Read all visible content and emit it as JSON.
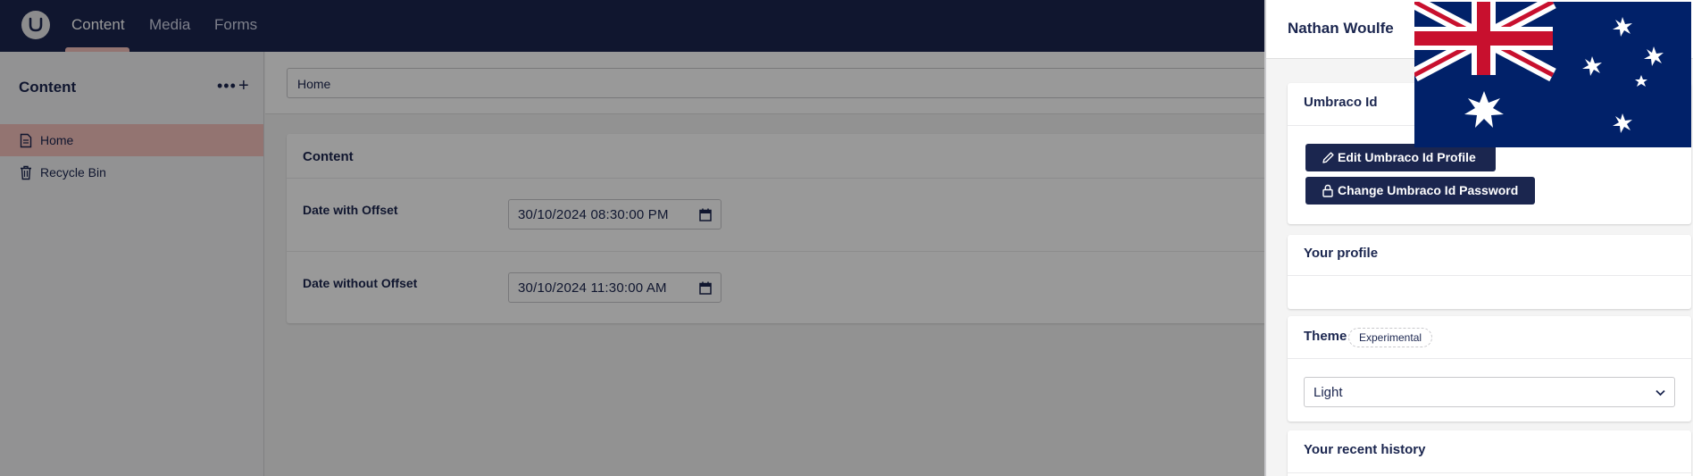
{
  "header": {
    "tabs": [
      {
        "label": "Content",
        "active": true
      },
      {
        "label": "Media",
        "active": false
      },
      {
        "label": "Forms",
        "active": false
      }
    ],
    "accent": "#f5c1bc",
    "background": "#1b264f"
  },
  "sidebar": {
    "title": "Content",
    "more_icon": "ellipsis-icon",
    "add_icon": "plus-icon",
    "items": [
      {
        "label": "Home",
        "icon": "document-icon",
        "selected": true
      },
      {
        "label": "Recycle Bin",
        "icon": "trash-icon",
        "selected": false
      }
    ]
  },
  "main": {
    "breadcrumb": "Home",
    "group_title": "Content",
    "properties": [
      {
        "label": "Date with Offset",
        "value": "30/10/2024 08:30:00 PM"
      },
      {
        "label": "Date without Offset",
        "value": "30/10/2024 11:30:00 AM"
      }
    ]
  },
  "panel": {
    "user_name": "Nathan Woulfe",
    "umbraco_id": {
      "title": "Umbraco Id",
      "edit_profile_label": "Edit Umbraco Id Profile",
      "change_password_label": "Change Umbraco Id Password"
    },
    "profile": {
      "title": "Your profile"
    },
    "theme": {
      "title": "Theme",
      "tag": "Experimental",
      "selected": "Light"
    },
    "history": {
      "title": "Your recent history"
    }
  }
}
